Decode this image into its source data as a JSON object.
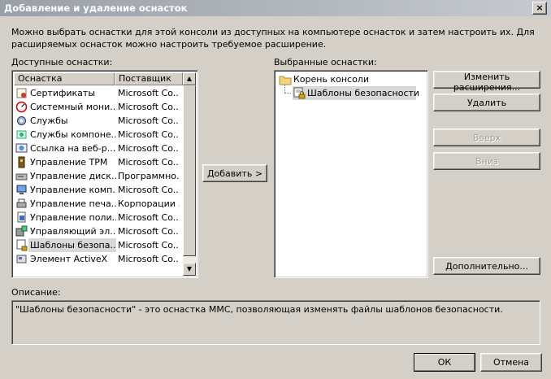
{
  "window": {
    "title": "Добавление и удаление оснасток",
    "close_label": "×"
  },
  "intro_text": "Можно выбрать оснастки для этой консоли из доступных на компьютере оснасток и затем настроить их. Для расширяемых оснасток можно настроить требуемое расширение.",
  "available": {
    "label": "Доступные оснастки:",
    "columns": [
      "Оснастка",
      "Поставщик"
    ],
    "items": [
      {
        "name": "Сертификаты",
        "vendor": "Microsoft Co...",
        "icon": "certificates-icon"
      },
      {
        "name": "Системный мони...",
        "vendor": "Microsoft Co...",
        "icon": "system-monitor-icon"
      },
      {
        "name": "Службы",
        "vendor": "Microsoft Co...",
        "icon": "services-icon"
      },
      {
        "name": "Службы компоне...",
        "vendor": "Microsoft Co...",
        "icon": "component-services-icon"
      },
      {
        "name": "Ссылка на веб-р...",
        "vendor": "Microsoft Co...",
        "icon": "web-link-icon"
      },
      {
        "name": "Управление TPM",
        "vendor": "Microsoft Co...",
        "icon": "tpm-icon"
      },
      {
        "name": "Управление диск...",
        "vendor": "Программно...",
        "icon": "disk-management-icon"
      },
      {
        "name": "Управление комп...",
        "vendor": "Microsoft Co...",
        "icon": "computer-management-icon"
      },
      {
        "name": "Управление печа...",
        "vendor": "Корпорации ...",
        "icon": "print-management-icon"
      },
      {
        "name": "Управление поли...",
        "vendor": "Microsoft Co...",
        "icon": "policy-management-icon"
      },
      {
        "name": "Управляющий эл...",
        "vendor": "Microsoft Co...",
        "icon": "wmi-control-icon"
      },
      {
        "name": "Шаблоны безопа...",
        "vendor": "Microsoft Co...",
        "icon": "security-templates-icon",
        "selected": true
      },
      {
        "name": "Элемент ActiveX",
        "vendor": "Microsoft Co...",
        "icon": "activex-icon"
      }
    ]
  },
  "add_button": "Добавить >",
  "selected": {
    "label": "Выбранные оснастки:",
    "root": "Корень консоли",
    "child": "Шаблоны безопасности"
  },
  "buttons": {
    "edit_extensions": "Изменить расширения...",
    "remove": "Удалить",
    "up": "Вверх",
    "down": "Вниз",
    "advanced": "Дополнительно...",
    "ok": "ОК",
    "cancel": "Отмена"
  },
  "description": {
    "label": "Описание:",
    "text": "\"Шаблоны безопасности\" - это оснастка MMC, позволяющая изменять файлы шаблонов безопасности."
  }
}
